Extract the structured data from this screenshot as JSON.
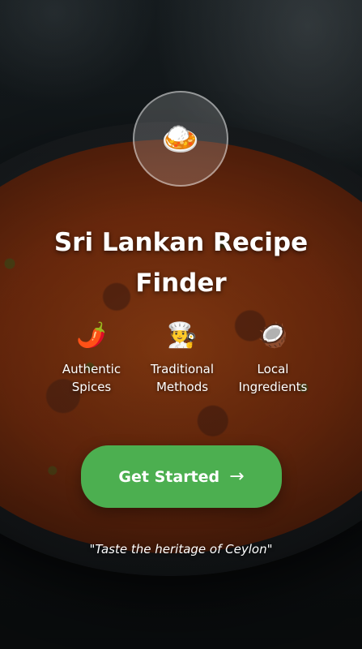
{
  "app": {
    "logo_icon": "🍛",
    "logo_icon_name": "curry-rice-icon",
    "title": "Sri Lankan Recipe Finder"
  },
  "features": [
    {
      "icon": "🌶️",
      "icon_name": "chili-pepper-icon",
      "label": "Authentic Spices"
    },
    {
      "icon": "🧑‍🍳",
      "icon_name": "chef-icon",
      "label": "Traditional Methods"
    },
    {
      "icon": "🥥",
      "icon_name": "coconut-icon",
      "label": "Local Ingredients"
    }
  ],
  "cta": {
    "label": "Get Started",
    "arrow": "→"
  },
  "tagline": "\"Taste the heritage of Ceylon\"",
  "colors": {
    "accent": "#4caf50",
    "text": "#ffffff"
  }
}
